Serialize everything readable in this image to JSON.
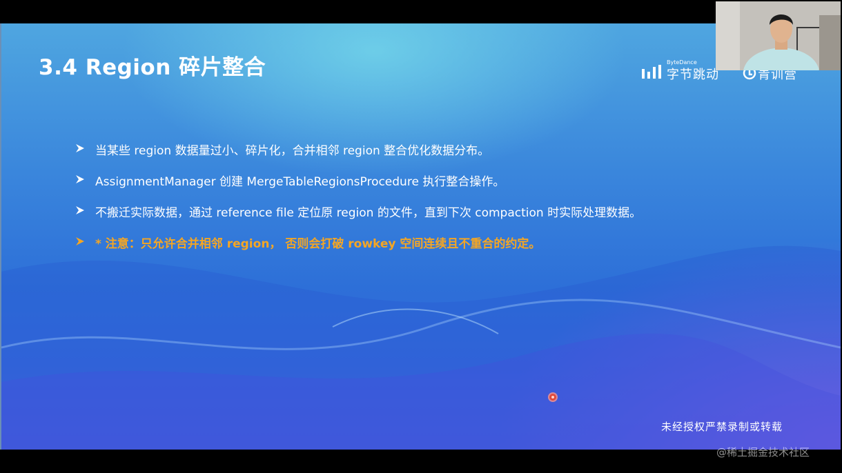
{
  "slide": {
    "title": "3.4 Region 碎片整合",
    "brand": {
      "company_small": "ByteDance",
      "company_name": "字节跳动",
      "program_name": "青训营"
    },
    "bullets": [
      {
        "text": "当某些 region 数据量过小、碎片化，合并相邻 region 整合优化数据分布。",
        "style": "normal"
      },
      {
        "text": "AssignmentManager 创建 MergeTableRegionsProcedure 执行整合操作。",
        "style": "normal"
      },
      {
        "text": "不搬迁实际数据，通过 reference file 定位原 region 的文件，直到下次 compaction 时实际处理数据。",
        "style": "normal"
      },
      {
        "text": "* 注意：只允许合并相邻 region， 否则会打破 rowkey 空间连续且不重合的约定。",
        "style": "warning"
      }
    ],
    "copyright": "未经授权严禁录制或转载"
  },
  "watermark": "@稀土掘金技术社区",
  "colors": {
    "warning_text": "#f5a623",
    "slide_blue": "#2d6fd8",
    "slide_purple": "#965feb"
  },
  "icons": {
    "bullet": "arrowhead-icon",
    "brand_bars": "bytedance-bars-icon",
    "program_logo": "youth-camp-logo-icon",
    "pointer": "laser-pointer-dot"
  }
}
